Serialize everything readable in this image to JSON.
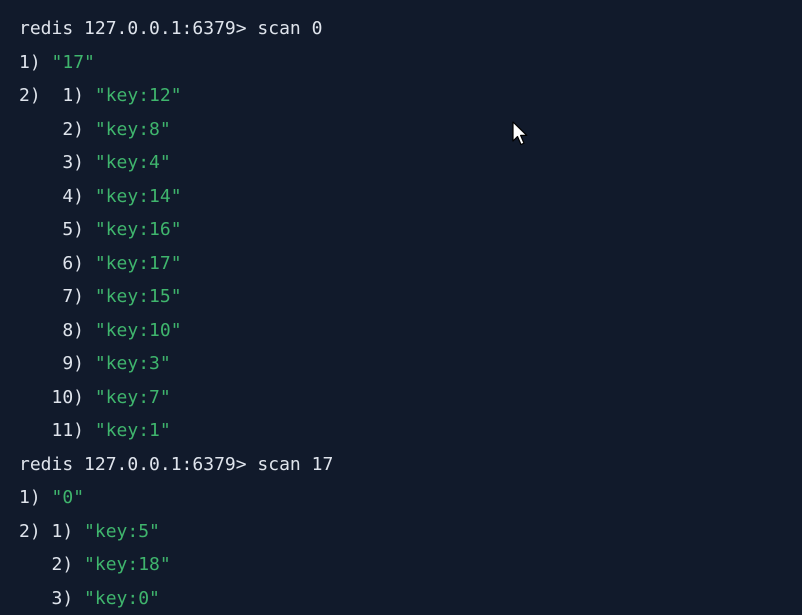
{
  "colors": {
    "background": "#111a2b",
    "text": "#dfe4ec",
    "string": "#3fb56d"
  },
  "lines": [
    {
      "prompt": "redis 127.0.0.1:6379> ",
      "command": "scan 0"
    },
    {
      "index": "1) ",
      "value": "\"17\""
    },
    {
      "index": "2)  1) ",
      "value": "\"key:12\""
    },
    {
      "index": "    2) ",
      "value": "\"key:8\""
    },
    {
      "index": "    3) ",
      "value": "\"key:4\""
    },
    {
      "index": "    4) ",
      "value": "\"key:14\""
    },
    {
      "index": "    5) ",
      "value": "\"key:16\""
    },
    {
      "index": "    6) ",
      "value": "\"key:17\""
    },
    {
      "index": "    7) ",
      "value": "\"key:15\""
    },
    {
      "index": "    8) ",
      "value": "\"key:10\""
    },
    {
      "index": "    9) ",
      "value": "\"key:3\""
    },
    {
      "index": "   10) ",
      "value": "\"key:7\""
    },
    {
      "index": "   11) ",
      "value": "\"key:1\""
    },
    {
      "prompt": "redis 127.0.0.1:6379> ",
      "command": "scan 17"
    },
    {
      "index": "1) ",
      "value": "\"0\""
    },
    {
      "index": "2) 1) ",
      "value": "\"key:5\""
    },
    {
      "index": "   2) ",
      "value": "\"key:18\""
    },
    {
      "index": "   3) ",
      "value": "\"key:0\""
    }
  ],
  "cursor_icon": "mouse-pointer-icon"
}
